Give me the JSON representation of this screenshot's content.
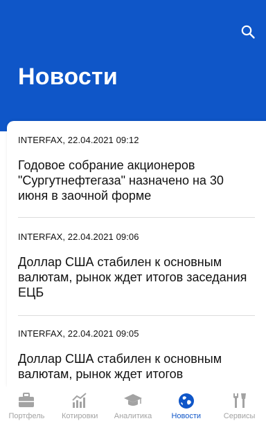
{
  "header": {
    "title": "Новости"
  },
  "news": [
    {
      "meta": "INTERFAX, 22.04.2021 09:12",
      "headline": "Годовое собрание акционеров \"Сургутнефтегаза\" назначено на 30 июня в заочной форме"
    },
    {
      "meta": "INTERFAX, 22.04.2021 09:06",
      "headline": "Доллар США стабилен к основным валютам, рынок ждет итогов заседания ЕЦБ"
    },
    {
      "meta": "INTERFAX, 22.04.2021 09:05",
      "headline": "Доллар США стабилен к основным валютам, рынок ждет итогов"
    }
  ],
  "tabs": [
    {
      "label": "Портфель",
      "icon": "briefcase-icon"
    },
    {
      "label": "Котировки",
      "icon": "chart-icon"
    },
    {
      "label": "Аналитика",
      "icon": "graduation-cap-icon"
    },
    {
      "label": "Новости",
      "icon": "globe-icon",
      "active": true
    },
    {
      "label": "Сервисы",
      "icon": "tools-icon"
    }
  ],
  "colors": {
    "primary": "#0f56c8",
    "inactive": "#a3a3a3"
  }
}
